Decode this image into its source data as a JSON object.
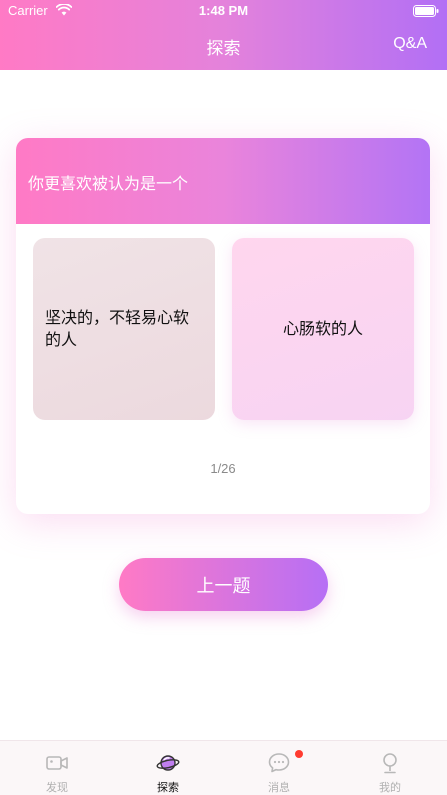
{
  "status_bar": {
    "carrier": "Carrier",
    "time": "1:48 PM"
  },
  "nav": {
    "title": "探索",
    "qa": "Q&A"
  },
  "question": {
    "text": "你更喜欢被认为是一个",
    "options": [
      "坚决的，不轻易心软的人",
      "心肠软的人"
    ],
    "progress": "1/26"
  },
  "prev_button": "上一题",
  "tabs": [
    {
      "label": "发现",
      "icon": "video-camera-icon",
      "active": false
    },
    {
      "label": "探索",
      "icon": "planet-icon",
      "active": true
    },
    {
      "label": "消息",
      "icon": "chat-bubble-icon",
      "active": false,
      "badge": true
    },
    {
      "label": "我的",
      "icon": "person-icon",
      "active": false
    }
  ],
  "colors": {
    "gradient_start": "#ff7ac5",
    "gradient_end": "#b26ff5",
    "badge": "#ff3b30"
  }
}
